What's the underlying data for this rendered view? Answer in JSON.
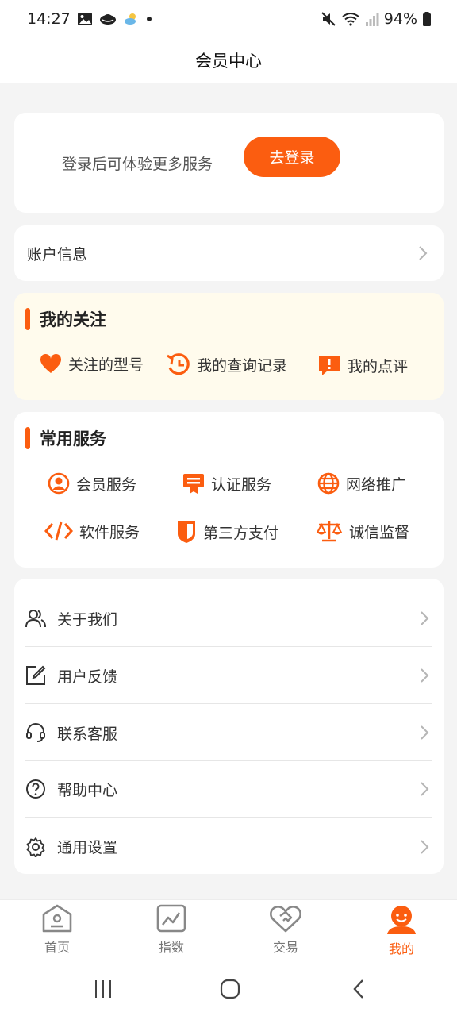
{
  "status_bar": {
    "time": "14:27",
    "battery": "94%",
    "icons": [
      "image-icon",
      "cloud-icon",
      "weather-icon",
      "dot-icon",
      "mute-icon",
      "wifi-icon",
      "signal-icon",
      "battery-icon"
    ]
  },
  "header": {
    "title": "会员中心"
  },
  "login": {
    "prompt": "登录后可体验更多服务",
    "button": "去登录"
  },
  "account": {
    "label": "账户信息"
  },
  "follow": {
    "title": "我的关注",
    "items": [
      {
        "label": "关注的型号",
        "icon": "heart-icon"
      },
      {
        "label": "我的查询记录",
        "icon": "history-icon"
      },
      {
        "label": "我的点评",
        "icon": "comment-icon"
      }
    ]
  },
  "services": {
    "title": "常用服务",
    "items": [
      {
        "label": "会员服务",
        "icon": "member-icon"
      },
      {
        "label": "认证服务",
        "icon": "certificate-icon"
      },
      {
        "label": "网络推广",
        "icon": "globe-icon"
      },
      {
        "label": "软件服务",
        "icon": "code-icon"
      },
      {
        "label": "第三方支付",
        "icon": "shield-icon"
      },
      {
        "label": "诚信监督",
        "icon": "scale-icon"
      }
    ]
  },
  "menu": {
    "items": [
      {
        "label": "关于我们",
        "icon": "users-icon"
      },
      {
        "label": "用户反馈",
        "icon": "edit-icon"
      },
      {
        "label": "联系客服",
        "icon": "headset-icon"
      },
      {
        "label": "帮助中心",
        "icon": "help-icon"
      },
      {
        "label": "通用设置",
        "icon": "settings-icon"
      }
    ]
  },
  "tabs": [
    {
      "label": "首页",
      "icon": "home-icon"
    },
    {
      "label": "指数",
      "icon": "chart-icon"
    },
    {
      "label": "交易",
      "icon": "handshake-icon"
    },
    {
      "label": "我的",
      "icon": "profile-icon",
      "active": true
    }
  ],
  "colors": {
    "accent": "#fb5d10",
    "follow_bg": "#fffbed",
    "page_bg": "#f4f4f4"
  }
}
